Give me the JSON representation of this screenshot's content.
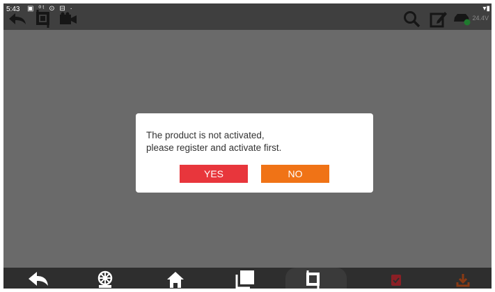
{
  "status_bar": {
    "time": "5:43",
    "icons": "▣ ⁰ᵗ ⊙ ⊟ ·",
    "wifi": "▾▮"
  },
  "toolbar": {
    "voltage": "24.4V",
    "icons": [
      "back-arrow-icon",
      "crop-icon",
      "video-icon",
      "search-icon",
      "edit-icon",
      "car-status-icon"
    ]
  },
  "dialog": {
    "message_line1": "The product is not activated,",
    "message_line2": "please register and activate first.",
    "yes_label": "YES",
    "no_label": "NO",
    "yes_color": "#e8363c",
    "no_color": "#f07316"
  },
  "bottom_nav": {
    "icons": [
      "back-icon",
      "steering-wheel-icon",
      "home-icon",
      "pages-icon",
      "crop-icon",
      "report-icon",
      "download-icon"
    ]
  },
  "colors": {
    "overlay": "#6a6a6a",
    "topbar": "#3f3f3f",
    "bottombar": "#2e2e2e"
  }
}
